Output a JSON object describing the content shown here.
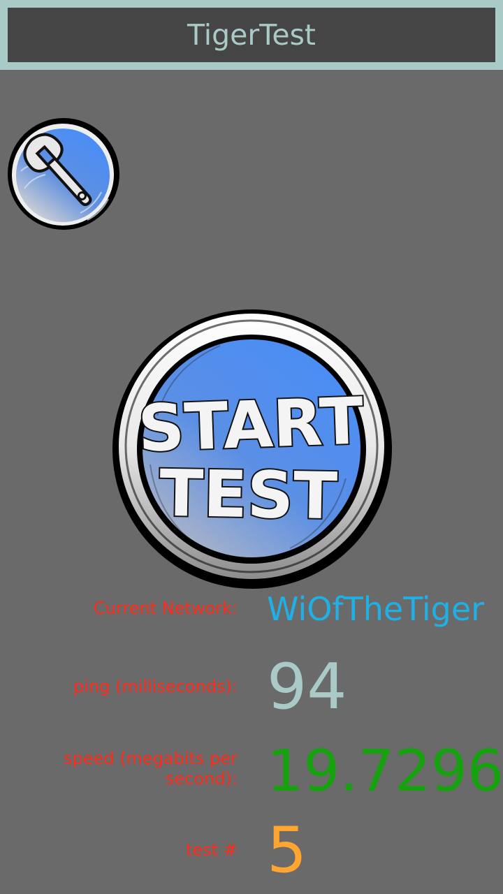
{
  "app": {
    "title": "TigerTest"
  },
  "buttons": {
    "start_line1": "START",
    "start_line2": "TEST",
    "settings_icon": "wrench-icon"
  },
  "stats": {
    "network": {
      "label": "Current Network:",
      "value": "WiOfTheTiger"
    },
    "ping": {
      "label": "ping (milliseconds):",
      "value": "94"
    },
    "speed": {
      "label_line1": "speed (megabits per",
      "label_line2": "second):",
      "value": "19.7296"
    },
    "test": {
      "label": "test #",
      "value": "5"
    }
  },
  "colors": {
    "background": "#6a6a6a",
    "titlebar_frame": "#a9cac7",
    "titlebar_fill": "#454545",
    "label": "#ff2a1a",
    "network": "#1fb0e6",
    "ping": "#a9cac7",
    "speed": "#16a20e",
    "test": "#ffa530",
    "button_blue": "#4a8df5"
  }
}
